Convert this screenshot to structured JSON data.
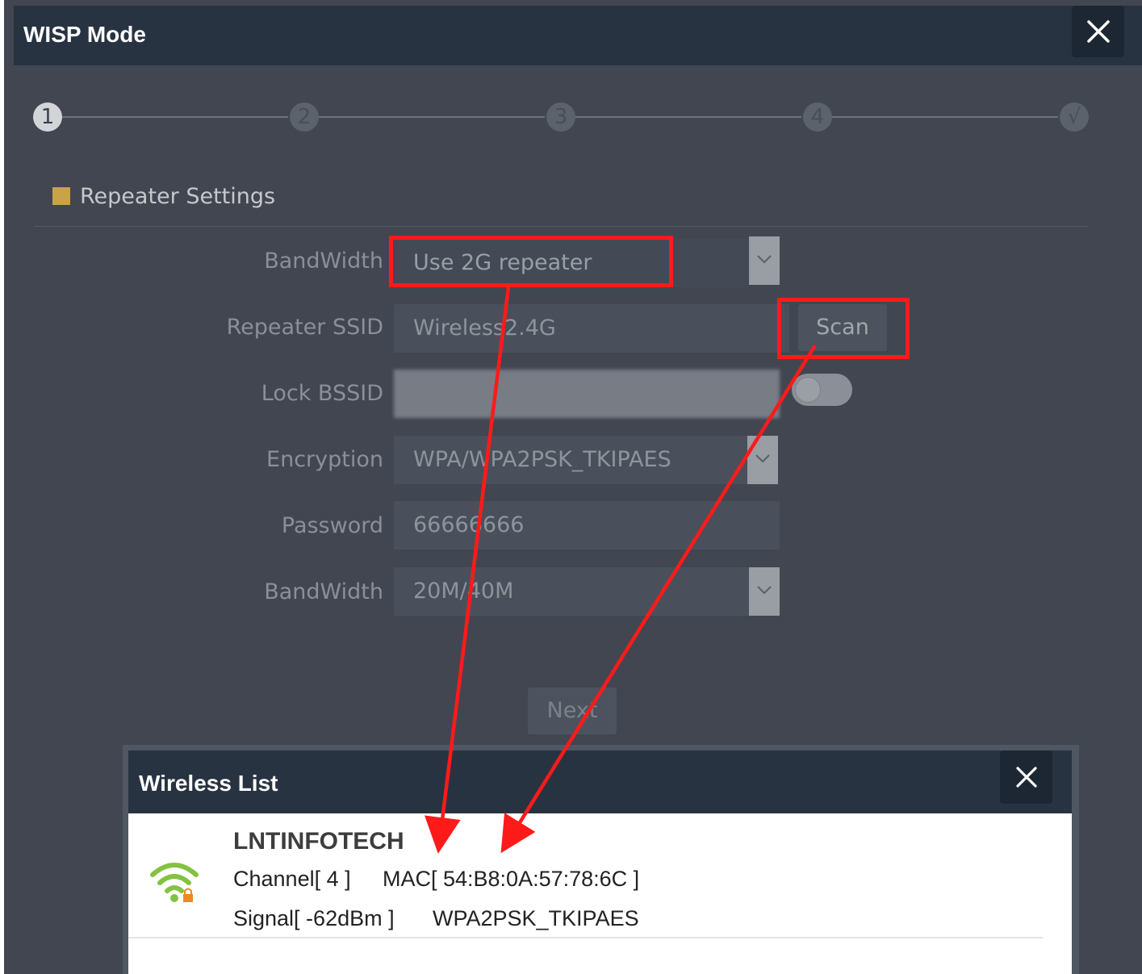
{
  "dialog": {
    "title": "WISP Mode",
    "close_icon": "close-icon"
  },
  "stepper": {
    "steps": [
      "1",
      "2",
      "3",
      "4",
      "√"
    ],
    "active_step": 1
  },
  "section": {
    "title": "Repeater Settings",
    "marker_color": "#c9a24a"
  },
  "form": {
    "bandwidth_label": "BandWidth",
    "bandwidth_value": "Use 2G repeater",
    "ssid_label": "Repeater SSID",
    "ssid_value": "Wireless2.4G",
    "scan_label": "Scan",
    "lock_bssid_label": "Lock BSSID",
    "encryption_label": "Encryption",
    "encryption_value": "WPA/WPA2PSK_TKIPAES",
    "password_label": "Password",
    "password_value": "66666666",
    "channel_bandwidth_label": "BandWidth",
    "channel_bandwidth_value": "20M/40M",
    "next_label": "Next"
  },
  "wireless_list": {
    "title": "Wireless List",
    "items": [
      {
        "ssid": "LNTINFOTECH",
        "channel_text": "Channel[ 4 ]",
        "mac_text": "MAC[ 54:B8:0A:57:78:6C ]",
        "signal_text": "Signal[ -62dBm ]",
        "security_text": "WPA2PSK_TKIPAES",
        "icon": "wifi-locked-icon"
      }
    ]
  },
  "annotation_color": "#ff1a1a"
}
